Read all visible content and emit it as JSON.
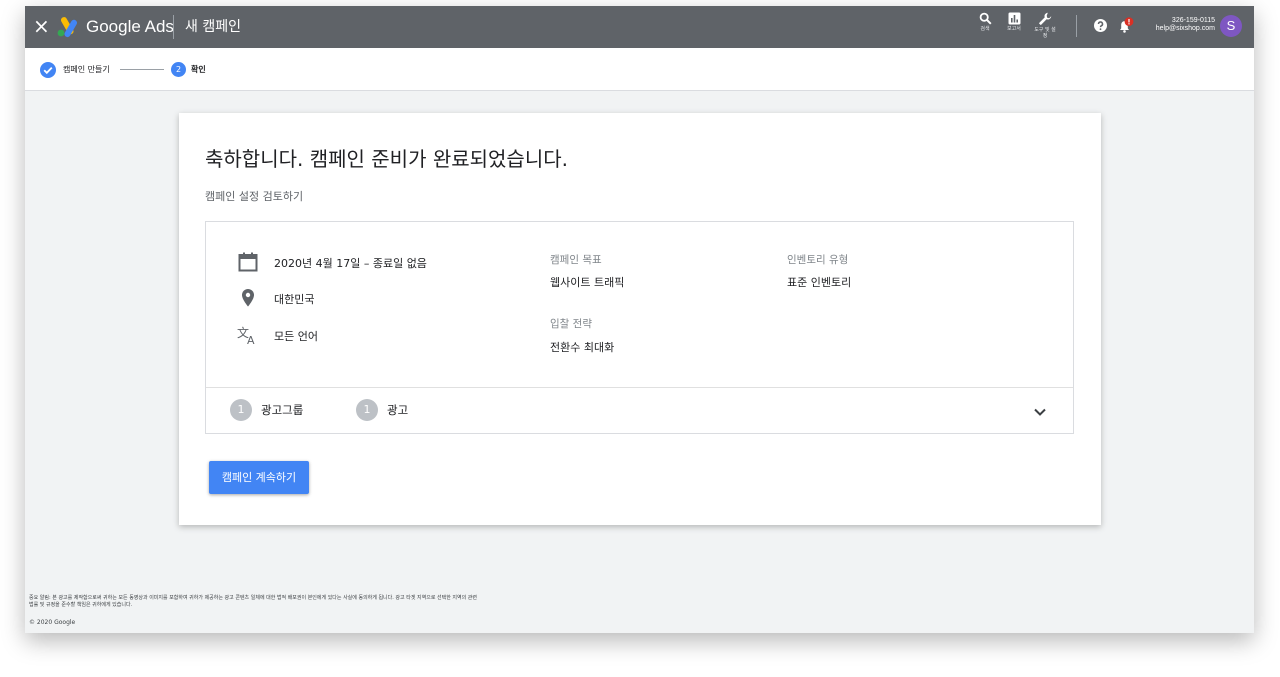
{
  "topbar": {
    "close_icon": "close-icon",
    "brand": "Google Ads",
    "title": "새 캠페인",
    "tools": [
      {
        "icon": "search-icon",
        "label": "검색"
      },
      {
        "icon": "reports-icon",
        "label": "보고서"
      },
      {
        "icon": "wrench-icon",
        "label": "도구 및 설정"
      }
    ],
    "account_id": "326-159-0115",
    "account_email": "help@sixshop.com",
    "avatar_letter": "S",
    "notification_badge_color": "#d93025",
    "bar_color": "#5f6368"
  },
  "stepper": {
    "step1_label": "캠페인 만들기",
    "step2_number": "2",
    "step2_label": "확인",
    "accent": "#4285f4"
  },
  "card": {
    "heading": "축하합니다. 캠페인 준비가 완료되었습니다.",
    "subheading": "캠페인 설정 검토하기",
    "summary": {
      "date": "2020년 4월 17일 – 종료일 없음",
      "location": "대한민국",
      "language": "모든 언어",
      "goal_label": "캠페인 목표",
      "goal_value": "웹사이트 트래픽",
      "bidding_label": "입찰 전략",
      "bidding_value": "전환수 최대화",
      "inventory_label": "인벤토리 유형",
      "inventory_value": "표준 인벤토리",
      "ad_group_count": "1",
      "ad_group_label": "광고그룹",
      "ad_count": "1",
      "ad_label": "광고"
    },
    "continue_button": "캠페인 계속하기"
  },
  "footer": {
    "notice_line1": "중요 알림: 본 광고를 제작함으로써 귀하는 모든 동영상과 이미지를 포함하여 귀하가 제공하는 광고 콘텐츠 일체에 대한 법적 배포권이 본인에게 있다는 사실에 동의하게 됩니다. 광고 타겟 지역으로 선택한 지역의 관련",
    "notice_line2": "법률 및 규정을 준수할 책임은 귀하에게 있습니다.",
    "copyright": "© 2020 Google"
  }
}
